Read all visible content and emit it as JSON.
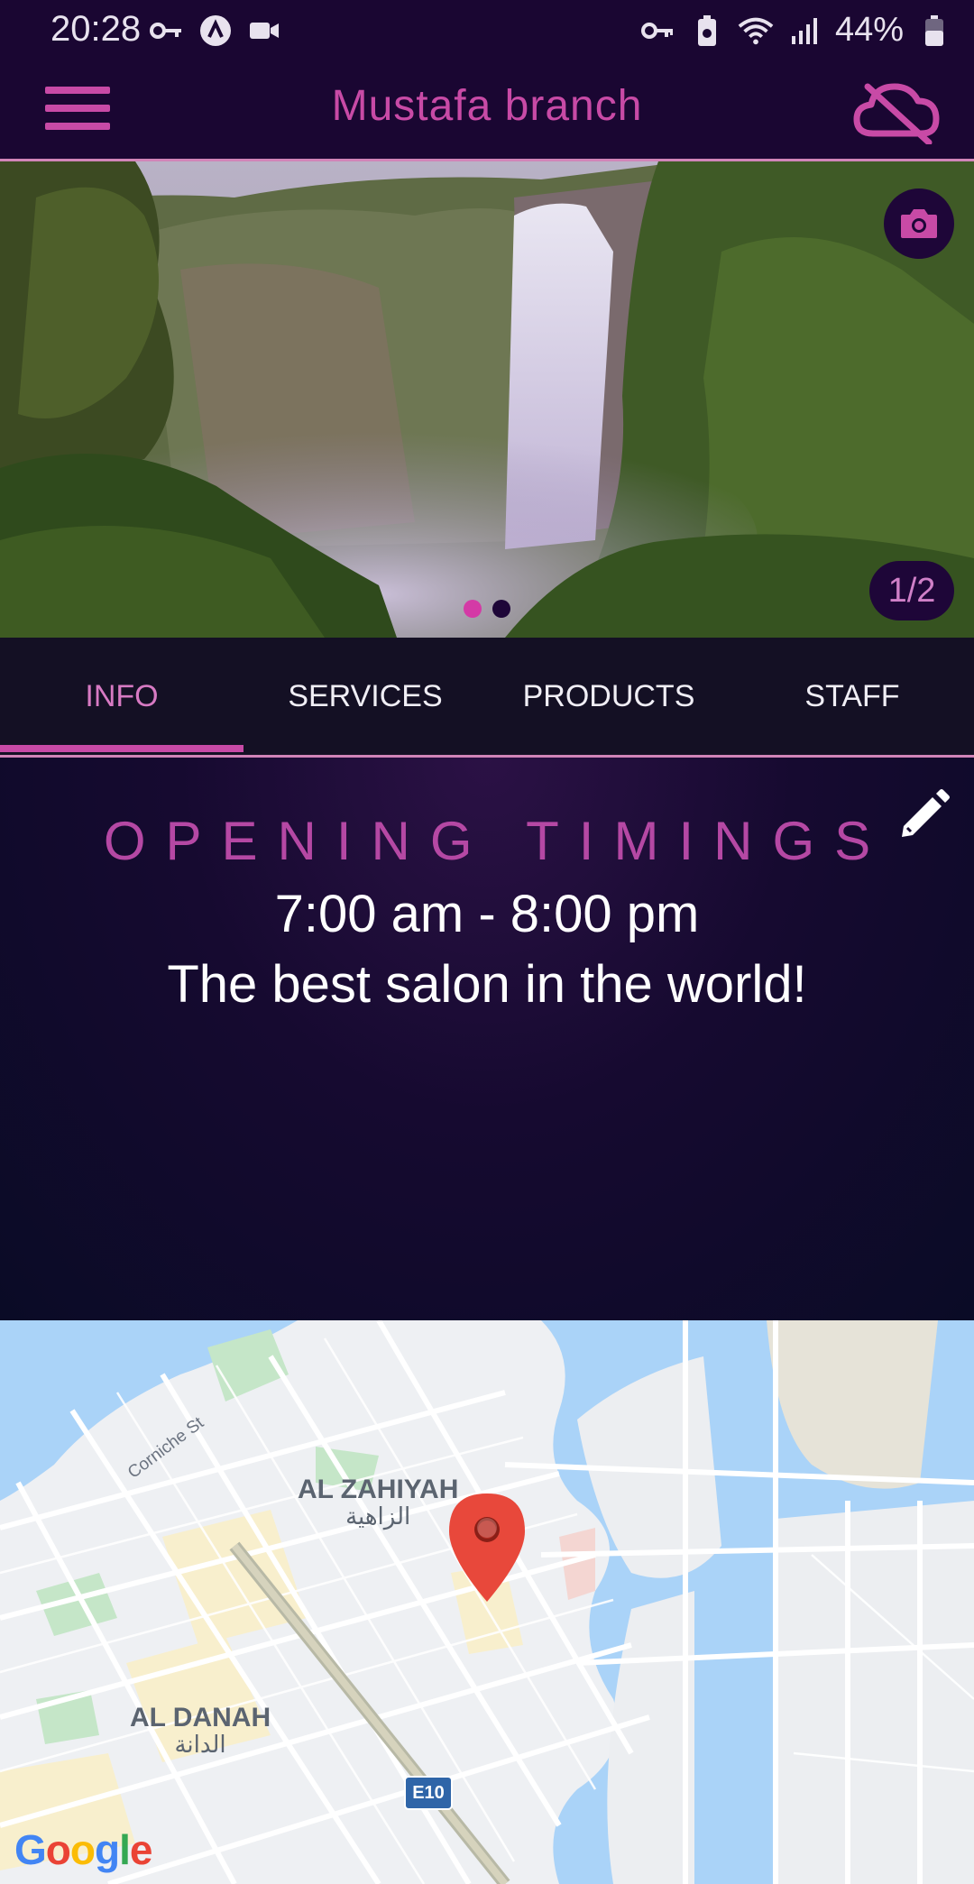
{
  "status_bar": {
    "time": "20:28",
    "battery_percent": "44%",
    "left_icons": [
      "key-icon",
      "app-circle-icon",
      "video-icon"
    ],
    "right_icons": [
      "vpn-key-icon",
      "battery-saver-icon",
      "wifi-icon",
      "signal-icon",
      "battery-icon"
    ]
  },
  "app_bar": {
    "title": "Mustafa branch",
    "accent_color": "#c84aa6",
    "background_color": "#1a0632",
    "menu_icon": "hamburger-menu-icon",
    "cloud_icon": "cloud-off-icon"
  },
  "gallery": {
    "counter": "1/2",
    "current_index": 1,
    "total": 2,
    "camera_icon": "camera-icon"
  },
  "tabs": {
    "active": "INFO",
    "items": [
      {
        "label": "INFO"
      },
      {
        "label": "SERVICES"
      },
      {
        "label": "PRODUCTS"
      },
      {
        "label": "STAFF"
      }
    ]
  },
  "info": {
    "heading": "OPENING TIMINGS",
    "hours": "7:00 am - 8:00 pm",
    "description": "The best salon in the world!",
    "edit_icon": "pencil-icon"
  },
  "map": {
    "labels": [
      {
        "en": "AL ZAHIYAH",
        "ar": "الزاهية"
      },
      {
        "en": "AL DANAH",
        "ar": "الدانة"
      }
    ],
    "street": "Corniche St",
    "road_shield": "E10",
    "brand": "Google",
    "marker_color": "#e8483b"
  }
}
